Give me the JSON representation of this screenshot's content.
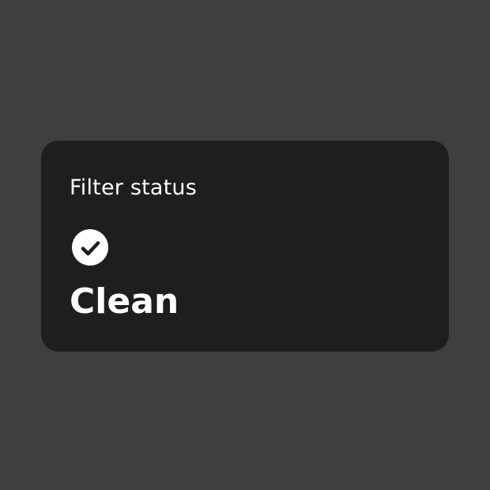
{
  "widget": {
    "title": "Filter status",
    "status_icon": "check-circle-icon",
    "status_value": "Clean"
  },
  "colors": {
    "background": "#3f3f3f",
    "card": "#1e1e1e",
    "text": "#ffffff",
    "icon_fill": "#ffffff",
    "icon_check": "#1e1e1e"
  }
}
